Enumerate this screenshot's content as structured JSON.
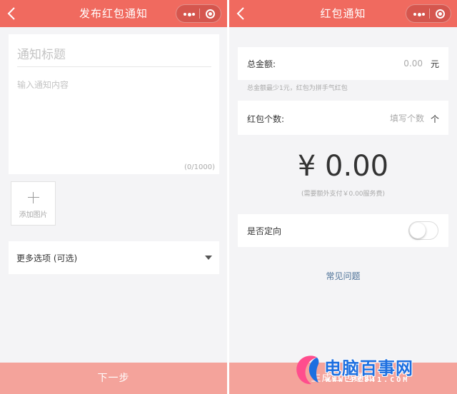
{
  "left_screen": {
    "header": {
      "title": "发布红包通知"
    },
    "form": {
      "title_placeholder": "通知标题",
      "content_placeholder": "输入通知内容",
      "char_count": "(0/1000)"
    },
    "add_image": {
      "label": "添加图片"
    },
    "more_options": {
      "label": "更多选项 (可选)"
    },
    "next_button": {
      "label": "下一步"
    }
  },
  "right_screen": {
    "header": {
      "title": "红包通知"
    },
    "total_amount": {
      "label": "总金额:",
      "placeholder": "0.00",
      "unit": "元"
    },
    "amount_hint": "总金额最少1元，红包为拼手气红包",
    "packet_count": {
      "label": "红包个数:",
      "placeholder": "填写个数",
      "unit": "个"
    },
    "big_amount": "¥ 0.00",
    "fee_note": "(需要额外支付￥0.00服务费)",
    "directed": {
      "label": "是否定向",
      "enabled": false
    },
    "faq_link": "常见问题",
    "generate_button": {
      "label": "生成红包通知"
    }
  },
  "watermark": {
    "text": "电脑百事网",
    "url": "WWW.PC841.COM"
  },
  "colors": {
    "header_red": "#f06a5f",
    "button_pink": "#f4a39b",
    "link_blue": "#4a6f96",
    "watermark_blue": "#1d6fe0"
  },
  "icons": [
    "back-icon",
    "more-dots-icon",
    "close-target-icon",
    "plus-icon",
    "dropdown-arrow-icon",
    "toggle-switch"
  ]
}
